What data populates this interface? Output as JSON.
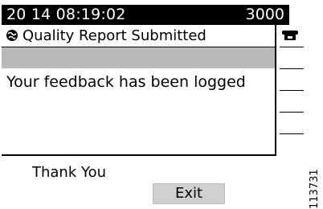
{
  "status_bar": {
    "datetime": "20 14 08:19:02",
    "extension": "3000"
  },
  "panel": {
    "title": "Quality Report Submitted",
    "title_icon": "globe-icon",
    "message": "Your feedback has been logged"
  },
  "line_keys": {
    "icon": "phone-icon"
  },
  "prompt": "Thank You",
  "softkeys": {
    "exit_label": "Exit"
  },
  "side_code": "113731",
  "colors": {
    "status_bar_bg": "#000000",
    "highlight": "#b9b9b9",
    "softkey_bg": "#d0d0d0"
  }
}
